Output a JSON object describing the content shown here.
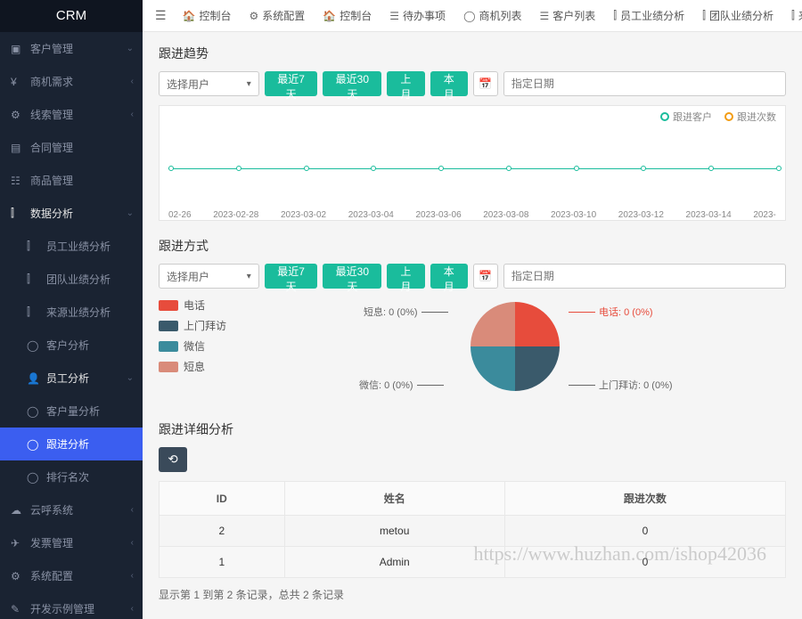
{
  "brand": "CRM",
  "sidebar": {
    "items": [
      {
        "icon": "▣",
        "label": "客户管理",
        "chev": "⌄"
      },
      {
        "icon": "¥",
        "label": "商机需求",
        "chev": "‹"
      },
      {
        "icon": "⚙",
        "label": "线索管理",
        "chev": "‹"
      },
      {
        "icon": "▤",
        "label": "合同管理"
      },
      {
        "icon": "☷",
        "label": "商品管理"
      },
      {
        "icon": "⫿",
        "label": "数据分析",
        "chev": "⌄",
        "open": true
      },
      {
        "icon": "⫿",
        "label": "员工业绩分析",
        "level": 2
      },
      {
        "icon": "⫿",
        "label": "团队业绩分析",
        "level": 2
      },
      {
        "icon": "⫿",
        "label": "来源业绩分析",
        "level": 2
      },
      {
        "icon": "◯",
        "label": "客户分析",
        "level": 2
      },
      {
        "icon": "👤",
        "label": "员工分析",
        "level": 2,
        "chev": "⌄",
        "open": true
      },
      {
        "icon": "◯",
        "label": "客户量分析",
        "level": 2
      },
      {
        "icon": "◯",
        "label": "跟进分析",
        "level": 2,
        "active": true
      },
      {
        "icon": "◯",
        "label": "排行名次",
        "level": 2
      },
      {
        "icon": "☁",
        "label": "云呼系统",
        "chev": "‹"
      },
      {
        "icon": "✈",
        "label": "发票管理",
        "chev": "‹"
      },
      {
        "icon": "⚙",
        "label": "系统配置",
        "chev": "‹"
      },
      {
        "icon": "✎",
        "label": "开发示例管理",
        "chev": "‹"
      }
    ]
  },
  "topbar": [
    {
      "icon": "☰",
      "label": ""
    },
    {
      "icon": "🏠",
      "label": "控制台"
    },
    {
      "icon": "⚙",
      "label": "系统配置"
    },
    {
      "icon": "🏠",
      "label": "控制台"
    },
    {
      "icon": "☰",
      "label": "待办事项"
    },
    {
      "icon": "◯",
      "label": "商机列表"
    },
    {
      "icon": "☰",
      "label": "客户列表"
    },
    {
      "icon": "⫿",
      "label": "员工业绩分析"
    },
    {
      "icon": "⫿",
      "label": "团队业绩分析"
    },
    {
      "icon": "⫿",
      "label": "来源业绩"
    }
  ],
  "sections": {
    "trend_title": "跟进趋势",
    "method_title": "跟进方式",
    "detail_title": "跟进详细分析"
  },
  "filters": {
    "select_placeholder": "选择用户",
    "btn_7d": "最近7天",
    "btn_30d": "最近30天",
    "btn_lastmonth": "上月",
    "btn_thismonth": "本月",
    "date_placeholder": "指定日期"
  },
  "chart_data": [
    {
      "type": "line",
      "title": "跟进趋势",
      "x": [
        "02-26",
        "2023-02-28",
        "2023-03-02",
        "2023-03-04",
        "2023-03-06",
        "2023-03-08",
        "2023-03-10",
        "2023-03-12",
        "2023-03-14",
        "2023-"
      ],
      "series": [
        {
          "name": "跟进客户",
          "color": "#1abc9c",
          "values": [
            0,
            0,
            0,
            0,
            0,
            0,
            0,
            0,
            0,
            0
          ]
        },
        {
          "name": "跟进次数",
          "color": "#f39c12",
          "values": [
            0,
            0,
            0,
            0,
            0,
            0,
            0,
            0,
            0,
            0
          ]
        }
      ],
      "ylim": [
        0,
        1
      ]
    },
    {
      "type": "pie",
      "title": "跟进方式",
      "series": [
        {
          "name": "电话",
          "color": "#e74c3c",
          "value": 0,
          "label": "电话: 0 (0%)"
        },
        {
          "name": "上门拜访",
          "color": "#3a5a6b",
          "value": 0,
          "label": "上门拜访: 0 (0%)"
        },
        {
          "name": "微信",
          "color": "#3b8b9c",
          "value": 0,
          "label": "微信: 0 (0%)"
        },
        {
          "name": "短息",
          "color": "#d98b7a",
          "value": 0,
          "label": "短息: 0 (0%)"
        }
      ]
    }
  ],
  "pie_legend": [
    {
      "color": "#e74c3c",
      "label": "电话"
    },
    {
      "color": "#3a5a6b",
      "label": "上门拜访"
    },
    {
      "color": "#3b8b9c",
      "label": "微信"
    },
    {
      "color": "#d98b7a",
      "label": "短息"
    }
  ],
  "table": {
    "headers": [
      "ID",
      "姓名",
      "跟进次数"
    ],
    "rows": [
      {
        "id": "2",
        "name": "metou",
        "count": "0"
      },
      {
        "id": "1",
        "name": "Admin",
        "count": "0"
      }
    ],
    "footer": "显示第 1 到第 2 条记录，总共 2 条记录"
  },
  "watermark": "https://www.huzhan.com/ishop42036"
}
